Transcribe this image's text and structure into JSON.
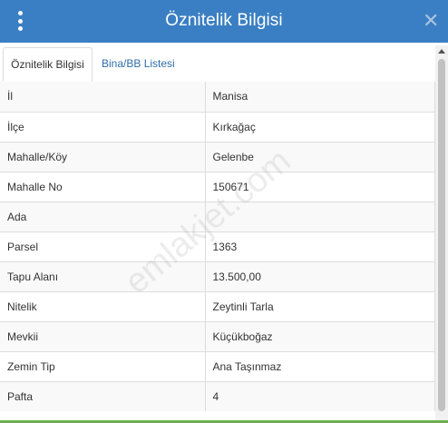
{
  "header": {
    "title": "Öznitelik Bilgisi",
    "background": "#3a7fc3"
  },
  "tabs": [
    {
      "label": "Öznitelik Bilgisi",
      "active": true
    },
    {
      "label": "Bina/BB Listesi",
      "active": false
    }
  ],
  "attributes": [
    {
      "key": "İl",
      "value": "Manisa"
    },
    {
      "key": "İlçe",
      "value": "Kırkağaç"
    },
    {
      "key": "Mahalle/Köy",
      "value": "Gelenbe"
    },
    {
      "key": "Mahalle No",
      "value": "150671"
    },
    {
      "key": "Ada",
      "value": ""
    },
    {
      "key": "Parsel",
      "value": "1363"
    },
    {
      "key": "Tapu Alanı",
      "value": "13.500,00"
    },
    {
      "key": "Nitelik",
      "value": "Zeytinli Tarla"
    },
    {
      "key": "Mevkii",
      "value": "Küçükboğaz"
    },
    {
      "key": "Zemin Tip",
      "value": "Ana Taşınmaz"
    },
    {
      "key": "Pafta",
      "value": "4"
    }
  ],
  "watermark": "emlakjet.com",
  "icons": {
    "menu": "vertical-ellipsis-icon",
    "close": "close-icon"
  }
}
